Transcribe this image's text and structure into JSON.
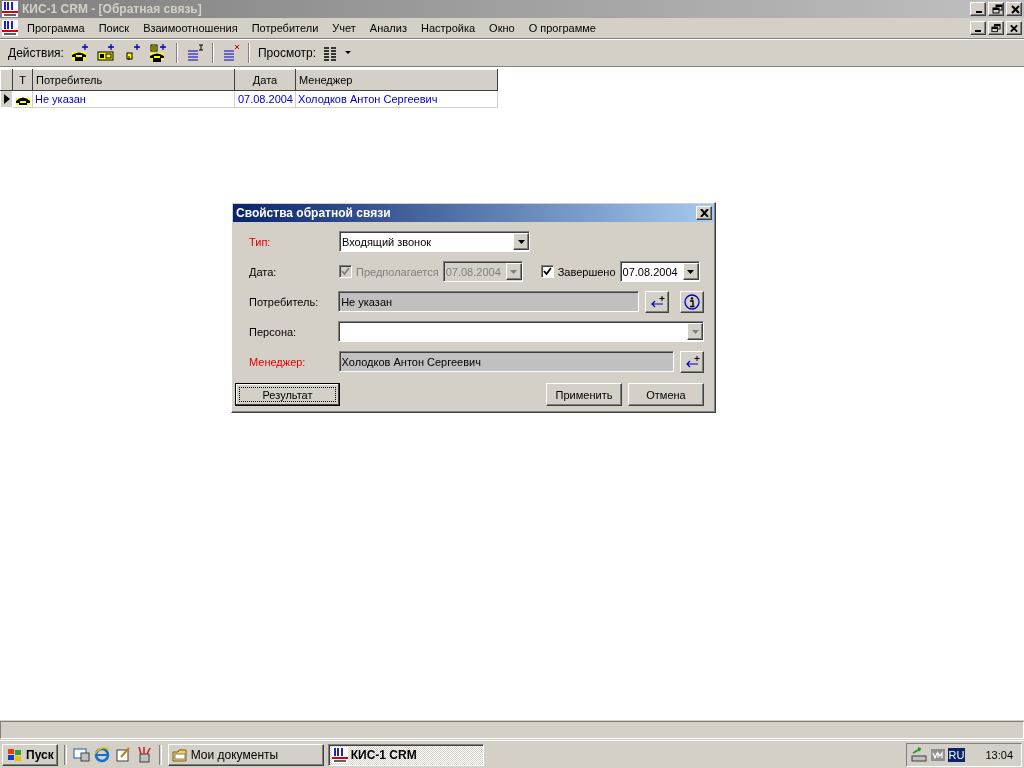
{
  "window": {
    "title": "КИС-1 CRM - [Обратная связь]"
  },
  "menu": [
    "Программа",
    "Поиск",
    "Взаимоотношения",
    "Потребители",
    "Учет",
    "Анализ",
    "Настройка",
    "Окно",
    "О программе"
  ],
  "toolbar": {
    "actions_label": "Действия:",
    "view_label": "Просмотр:"
  },
  "table": {
    "columns": [
      "Т",
      "Потребитель",
      "Дата",
      "Менеджер"
    ],
    "rows": [
      {
        "selected": true,
        "customer": "Не указан",
        "date": "07.08.2004",
        "manager": "Холодков Антон Сергеевич"
      }
    ]
  },
  "dialog": {
    "title": "Свойства обратной связи",
    "type": {
      "label": "Тип:",
      "required": true,
      "value": "Входящий звонок"
    },
    "date": {
      "label": "Дата:",
      "planned": {
        "label": "Предполагается",
        "checked": true,
        "disabled": true,
        "value": "07.08.2004"
      },
      "completed": {
        "label": "Завершено",
        "checked": true,
        "disabled": false,
        "value": "07.08.2004"
      }
    },
    "customer": {
      "label": "Потребитель:",
      "required": false,
      "value": "Не указан"
    },
    "person": {
      "label": "Персона:",
      "required": false
    },
    "manager": {
      "label": "Менеджер:",
      "required": true,
      "value": "Холодков Антон Сергеевич"
    },
    "buttons": [
      {
        "label": "Результат",
        "focused": true
      },
      {
        "label": "Применить",
        "focused": false
      },
      {
        "label": "Отмена",
        "focused": false
      }
    ]
  },
  "taskbar": {
    "start": "Пуск",
    "tasks": [
      {
        "label": "Мои документы",
        "selected": false
      },
      {
        "label": "КИС-1 CRM",
        "selected": true
      }
    ],
    "language": "RU",
    "clock": "13:04"
  }
}
